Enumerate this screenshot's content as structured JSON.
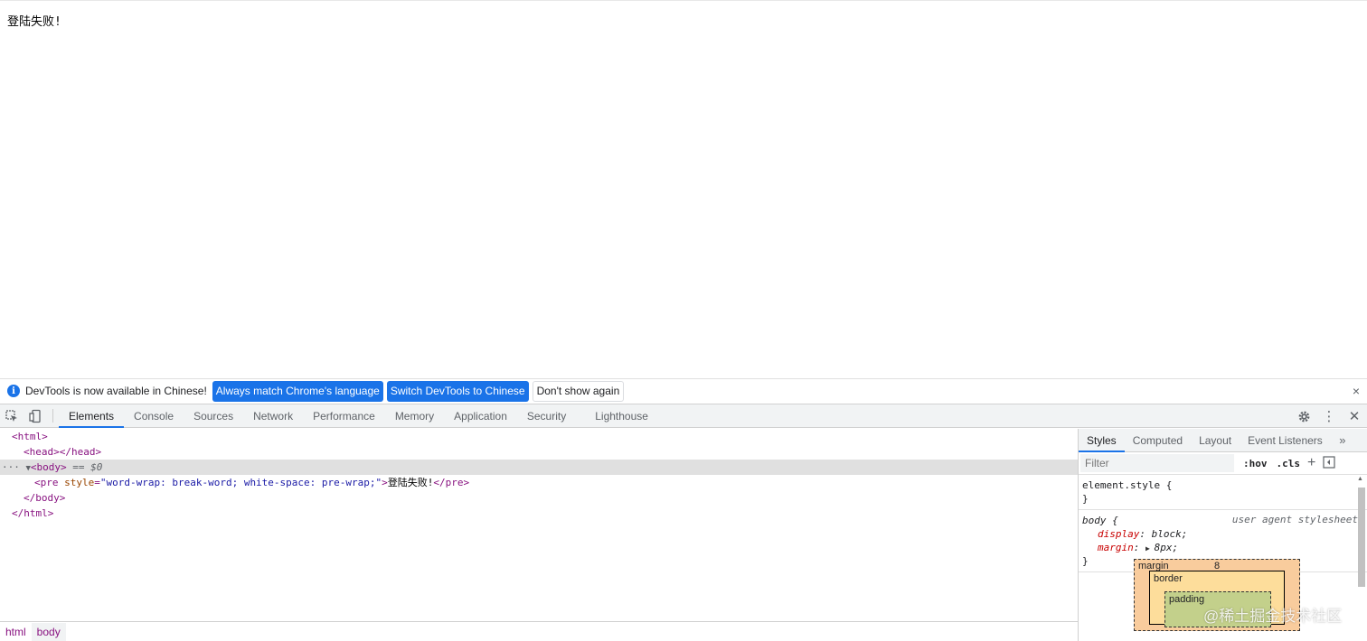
{
  "page": {
    "body_text": "登陆失败!"
  },
  "infobar": {
    "message": "DevTools is now available in Chinese!",
    "btn_match": "Always match Chrome's language",
    "btn_switch": "Switch DevTools to Chinese",
    "btn_dismiss": "Don't show again",
    "close": "×"
  },
  "toolbar": {
    "tabs": [
      "Elements",
      "Console",
      "Sources",
      "Network",
      "Performance",
      "Memory",
      "Application",
      "Security",
      "Lighthouse"
    ]
  },
  "elements": {
    "html_open": "<html>",
    "head": "<head></head>",
    "body_open": "<body>",
    "dollar": " == $0",
    "pre_open": "<pre ",
    "pre_attr": "style",
    "pre_attr_val": "\"word-wrap: break-word; white-space: pre-wrap;\"",
    "pre_text": "登陆失败!",
    "pre_close": "</pre>",
    "body_close": "</body>",
    "html_close": "</html>"
  },
  "breadcrumbs": [
    "html",
    "body"
  ],
  "sidebar": {
    "tabs": [
      "Styles",
      "Computed",
      "Layout",
      "Event Listeners"
    ],
    "filter_placeholder": "Filter",
    "hov": ":hov",
    "cls": ".cls",
    "element_style": "element.style {",
    "close_brace": "}",
    "body_selector": "body {",
    "ua_label": "user agent stylesheet",
    "display_prop": "display",
    "display_val": "block;",
    "margin_prop": "margin",
    "margin_val": "8px;",
    "box_margin_label": "margin",
    "box_margin_value": "8",
    "box_border_label": "border",
    "box_padding_label": "padding",
    "watermark": "@稀土掘金技术社区"
  }
}
